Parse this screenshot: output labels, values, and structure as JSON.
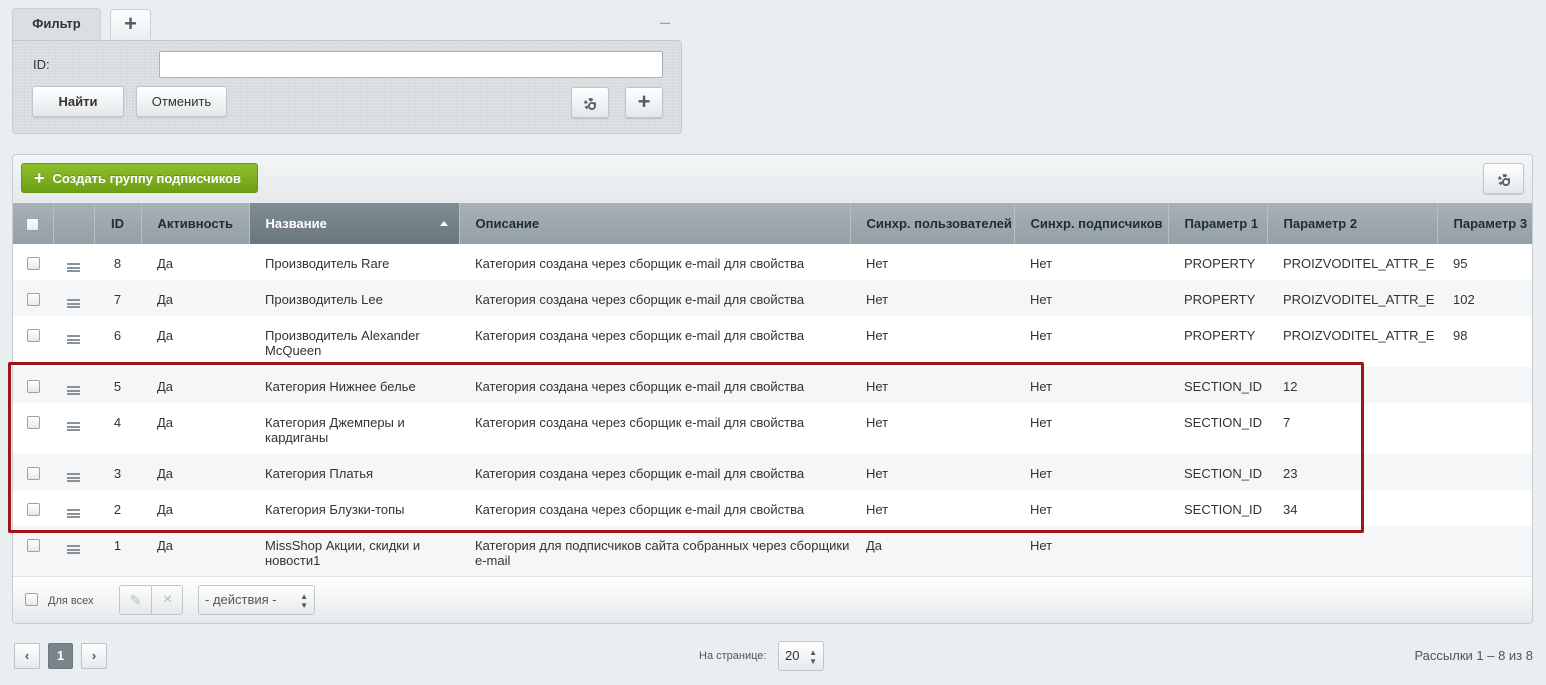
{
  "filter": {
    "tab_label": "Фильтр",
    "add_tab": "+",
    "collapse": "–",
    "id_label": "ID:",
    "id_value": "",
    "find_button": "Найти",
    "cancel_button": "Отменить",
    "add_button": "+"
  },
  "list": {
    "create_button": "Создать группу подписчиков",
    "columns": {
      "id": "ID",
      "active": "Активность",
      "name": "Название",
      "description": "Описание",
      "sync_users": "Синхр. пользователей",
      "sync_subscribers": "Синхр. подписчиков",
      "param1": "Параметр 1",
      "param2": "Параметр 2",
      "param3": "Параметр 3"
    },
    "rows": [
      {
        "id": "8",
        "active": "Да",
        "name": "Производитель Rare",
        "description": "Категория создана через сборщик e-mail для свойства",
        "sync_users": "Нет",
        "sync_subscribers": "Нет",
        "param1": "PROPERTY",
        "param2": "PROIZVODITEL_ATTR_E",
        "param3": "95"
      },
      {
        "id": "7",
        "active": "Да",
        "name": "Производитель Lee",
        "description": "Категория создана через сборщик e-mail для свойства",
        "sync_users": "Нет",
        "sync_subscribers": "Нет",
        "param1": "PROPERTY",
        "param2": "PROIZVODITEL_ATTR_E",
        "param3": "102"
      },
      {
        "id": "6",
        "active": "Да",
        "name": "Производитель Alexander McQueen",
        "description": "Категория создана через сборщик e-mail для свойства",
        "sync_users": "Нет",
        "sync_subscribers": "Нет",
        "param1": "PROPERTY",
        "param2": "PROIZVODITEL_ATTR_E",
        "param3": "98"
      },
      {
        "id": "5",
        "active": "Да",
        "name": "Категория Нижнее белье",
        "description": "Категория создана через сборщик e-mail для свойства",
        "sync_users": "Нет",
        "sync_subscribers": "Нет",
        "param1": "SECTION_ID",
        "param2": "12",
        "param3": ""
      },
      {
        "id": "4",
        "active": "Да",
        "name": "Категория Джемперы и кардиганы",
        "description": "Категория создана через сборщик e-mail для свойства",
        "sync_users": "Нет",
        "sync_subscribers": "Нет",
        "param1": "SECTION_ID",
        "param2": "7",
        "param3": ""
      },
      {
        "id": "3",
        "active": "Да",
        "name": "Категория Платья",
        "description": "Категория создана через сборщик e-mail для свойства",
        "sync_users": "Нет",
        "sync_subscribers": "Нет",
        "param1": "SECTION_ID",
        "param2": "23",
        "param3": ""
      },
      {
        "id": "2",
        "active": "Да",
        "name": "Категория Блузки-топы",
        "description": "Категория создана через сборщик e-mail для свойства",
        "sync_users": "Нет",
        "sync_subscribers": "Нет",
        "param1": "SECTION_ID",
        "param2": "34",
        "param3": ""
      },
      {
        "id": "1",
        "active": "Да",
        "name": "MissShop Акции, скидки и новости1",
        "description": "Категория для подписчиков сайта собранных через сборщики e-mail",
        "sync_users": "Да",
        "sync_subscribers": "Нет",
        "param1": "",
        "param2": "",
        "param3": ""
      }
    ],
    "footer": {
      "for_all_label": "Для всех",
      "actions_value": "- действия -"
    }
  },
  "pager": {
    "prev": "‹",
    "current_page": "1",
    "next": "›",
    "per_page_label": "На странице:",
    "per_page_value": "20",
    "count_label": "Рассылки 1 – 8 из 8"
  },
  "colors": {
    "create_button": "#7cae1d",
    "highlight_frame": "#a0151a",
    "sorted_header": "#75828a"
  }
}
